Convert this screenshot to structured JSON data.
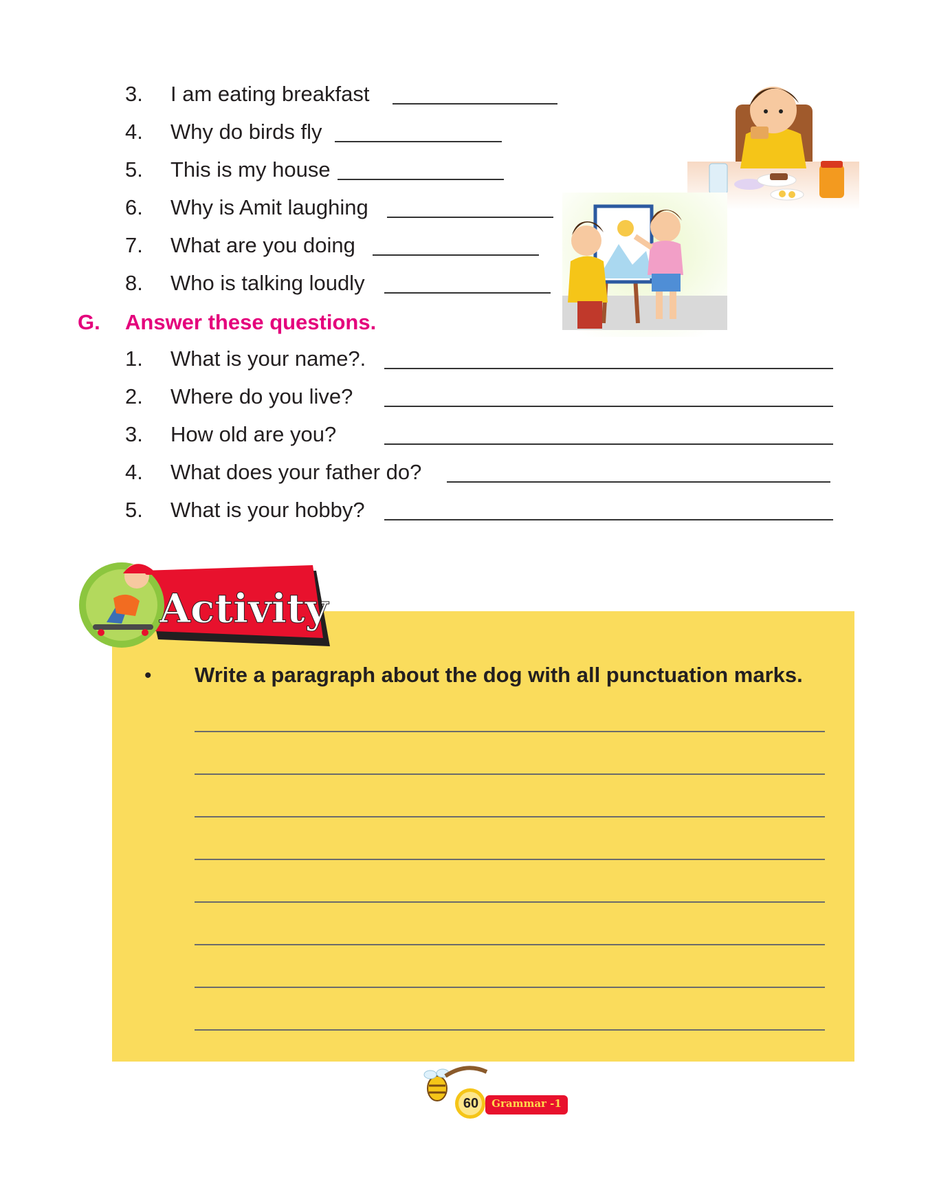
{
  "exercise_f": {
    "items": [
      {
        "num": "3.",
        "text": "I am eating breakfast"
      },
      {
        "num": "4.",
        "text": "Why do birds fly"
      },
      {
        "num": "5.",
        "text": "This is my house"
      },
      {
        "num": "6.",
        "text": "Why is Amit laughing"
      },
      {
        "num": "7.",
        "text": "What are you doing"
      },
      {
        "num": "8.",
        "text": "Who is talking loudly"
      }
    ]
  },
  "exercise_g": {
    "label": "G.",
    "heading": "Answer these questions.",
    "items": [
      {
        "num": "1.",
        "text": "What is your name?."
      },
      {
        "num": "2.",
        "text": "Where do you live?"
      },
      {
        "num": "3.",
        "text": "How old are you?"
      },
      {
        "num": "4.",
        "text": "What does your father do?"
      },
      {
        "num": "5.",
        "text": "What is your hobby?"
      }
    ]
  },
  "activity": {
    "banner": "Activity",
    "bullet": "•",
    "instruction": "Write a paragraph about the dog with all punctuation marks.",
    "lines": 8
  },
  "footer": {
    "page_number": "60",
    "book_title": "Grammar -1"
  },
  "colors": {
    "heading": "#e4007c",
    "activity_box": "#fadc5c",
    "banner_red": "#e8112d",
    "text": "#231f20"
  }
}
